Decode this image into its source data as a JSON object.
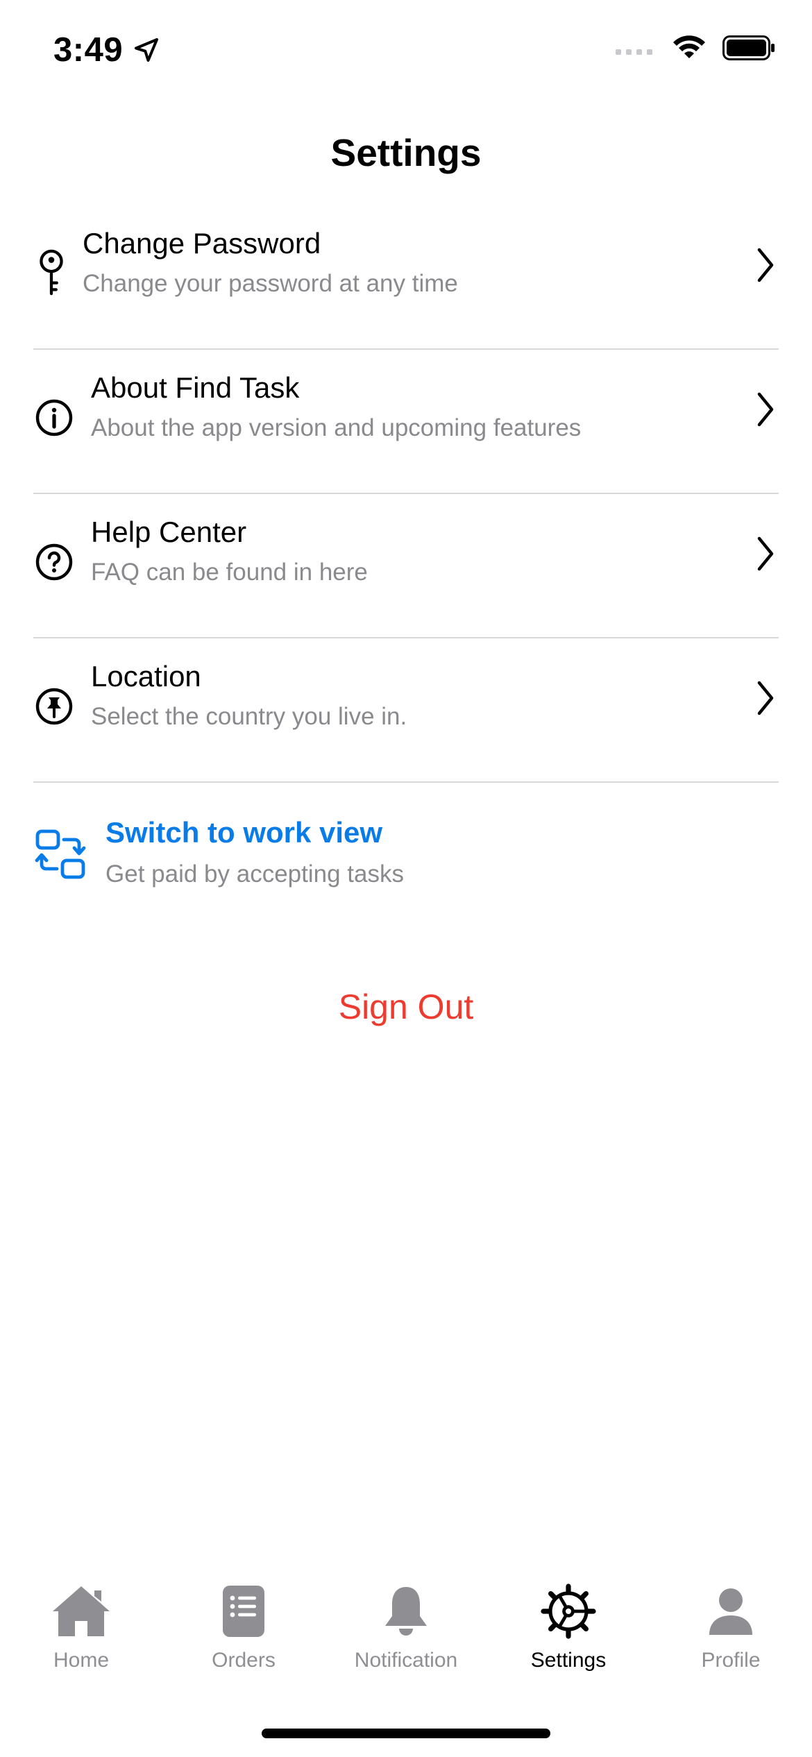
{
  "status_bar": {
    "time": "3:49",
    "icons": [
      "location-arrow-icon",
      "signal-icon",
      "wifi-icon",
      "battery-icon"
    ]
  },
  "header": {
    "title": "Settings"
  },
  "settings": {
    "items": [
      {
        "icon": "key-icon",
        "title": "Change Password",
        "subtitle": "Change your password at any time"
      },
      {
        "icon": "info-icon",
        "title": "About Find Task",
        "subtitle": "About the app version and upcoming features"
      },
      {
        "icon": "question-icon",
        "title": "Help Center",
        "subtitle": "FAQ can be found in here"
      },
      {
        "icon": "pin-icon",
        "title": "Location",
        "subtitle": "Select the country you live in."
      }
    ]
  },
  "switch_view": {
    "icon": "switch-view-icon",
    "title": "Switch to work view",
    "subtitle": "Get paid by accepting tasks"
  },
  "sign_out": {
    "label": "Sign Out"
  },
  "tab_bar": {
    "tabs": [
      {
        "label": "Home",
        "icon": "home-icon",
        "active": false
      },
      {
        "label": "Orders",
        "icon": "orders-icon",
        "active": false
      },
      {
        "label": "Notification",
        "icon": "bell-icon",
        "active": false
      },
      {
        "label": "Settings",
        "icon": "settings-wheel-icon",
        "active": true
      },
      {
        "label": "Profile",
        "icon": "profile-icon",
        "active": false
      }
    ]
  },
  "colors": {
    "accent_blue": "#0a7ce8",
    "danger_red": "#ee3b2f",
    "secondary_text": "#8a8a8e",
    "tab_inactive": "#8e8e93"
  }
}
